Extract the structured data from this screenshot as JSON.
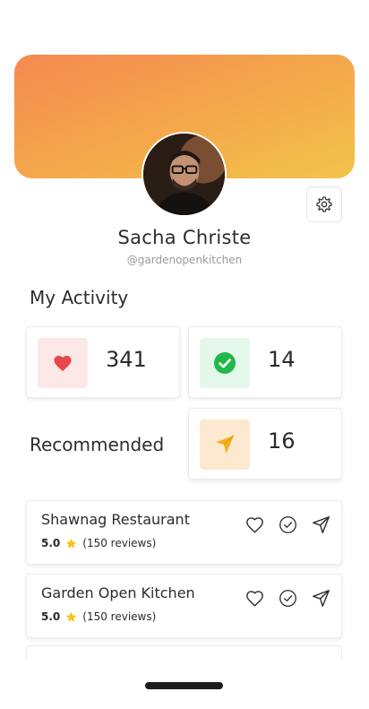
{
  "profile": {
    "name": "Sacha Christe",
    "handle": "@gardenopenkitchen",
    "avatar_icon": "person-photo"
  },
  "header": {
    "gradient_start": "#f48a52",
    "gradient_end": "#f2c44b"
  },
  "settings": {
    "icon": "gear-icon"
  },
  "activity": {
    "title": "My Activity",
    "stats": [
      {
        "icon": "heart-icon",
        "value": "341",
        "bg": "#fde8e8",
        "color": "#e8484b"
      },
      {
        "icon": "check-circle-icon",
        "value": "14",
        "bg": "#e3f8ea",
        "color": "#22b84a"
      },
      {
        "icon": "send-icon",
        "value": "16",
        "bg": "#fde9cf",
        "color": "#f4b01e"
      }
    ]
  },
  "recommended": {
    "label": "Recommended"
  },
  "restaurants": [
    {
      "name": "Shawnag Restaurant",
      "rating": "5.0",
      "reviews": "(150 reviews)"
    },
    {
      "name": "Garden Open Kitchen",
      "rating": "5.0",
      "reviews": "(150 reviews)"
    }
  ]
}
